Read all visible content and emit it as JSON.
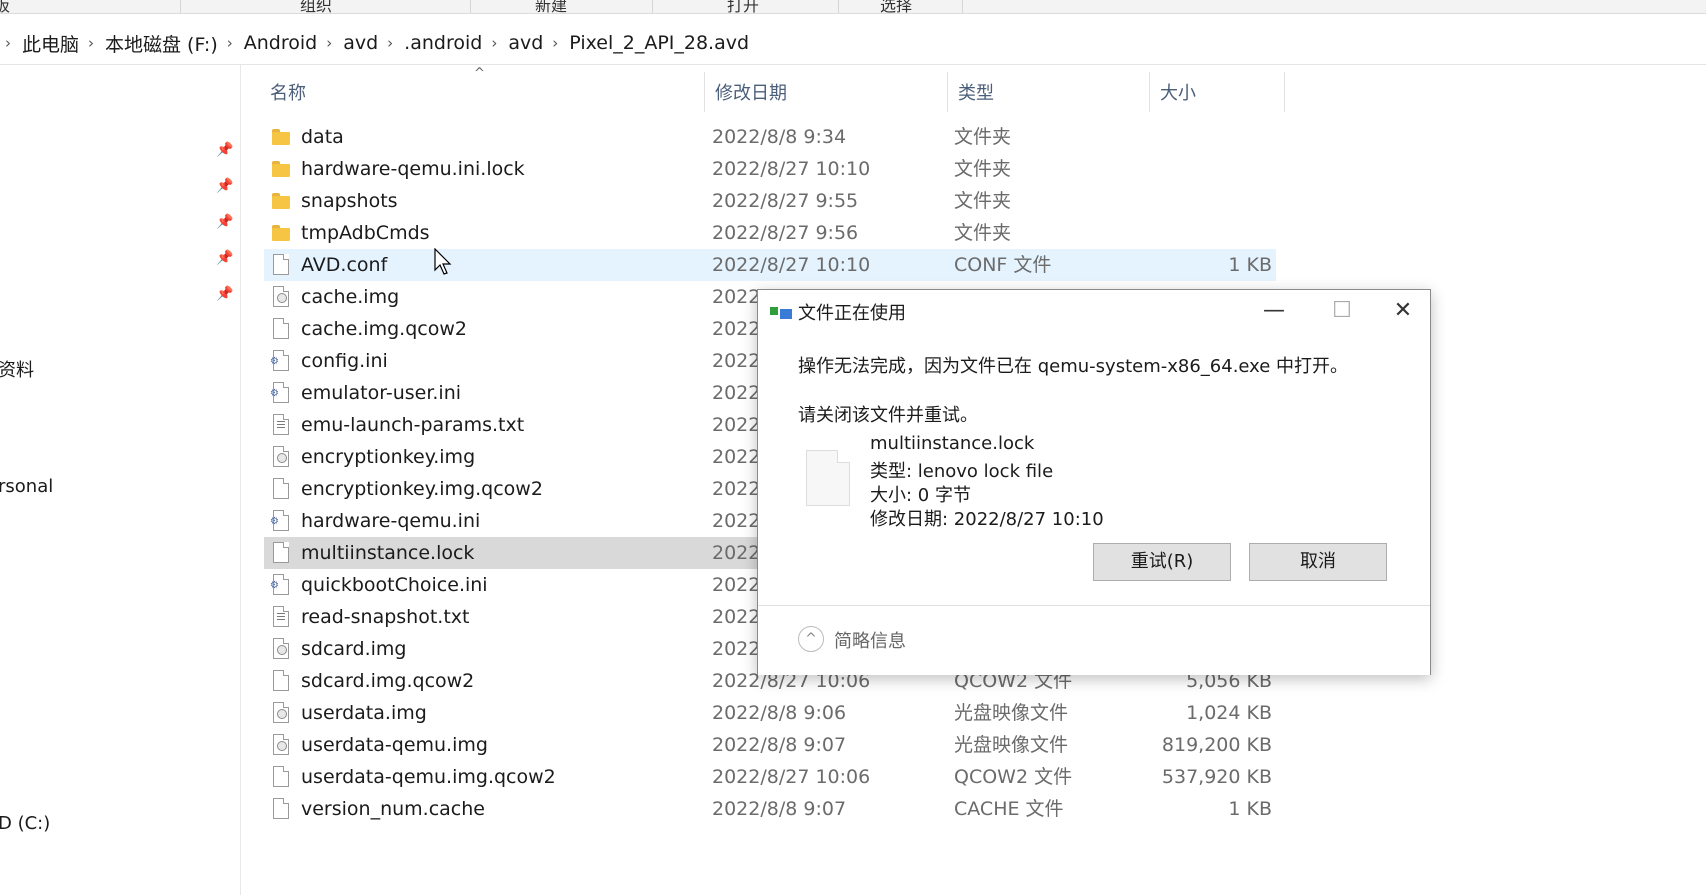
{
  "ribbon": {
    "groups": [
      "板",
      "组织",
      "新建",
      "打开",
      "选择"
    ]
  },
  "breadcrumb": [
    "此电脑",
    "本地磁盘 (F:)",
    "Android",
    "avd",
    ".android",
    "avd",
    "Pixel_2_API_28.avd"
  ],
  "nav": {
    "items": [
      "资料",
      "rsonal",
      "D (C:)"
    ]
  },
  "columns": {
    "name": "名称",
    "date": "修改日期",
    "type": "类型",
    "size": "大小"
  },
  "files": [
    {
      "name": "data",
      "date": "2022/8/8 9:34",
      "type": "文件夹",
      "size": "",
      "icon": "folder-icon"
    },
    {
      "name": "hardware-qemu.ini.lock",
      "date": "2022/8/27 10:10",
      "type": "文件夹",
      "size": "",
      "icon": "folder-icon"
    },
    {
      "name": "snapshots",
      "date": "2022/8/27 9:55",
      "type": "文件夹",
      "size": "",
      "icon": "folder-icon"
    },
    {
      "name": "tmpAdbCmds",
      "date": "2022/8/27 9:56",
      "type": "文件夹",
      "size": "",
      "icon": "folder-icon"
    },
    {
      "name": "AVD.conf",
      "date": "2022/8/27 10:10",
      "type": "CONF 文件",
      "size": "1 KB",
      "icon": "file-icon"
    },
    {
      "name": "cache.img",
      "date": "2022",
      "type": "",
      "size": "",
      "icon": "disc-file-icon"
    },
    {
      "name": "cache.img.qcow2",
      "date": "2022",
      "type": "",
      "size": "",
      "icon": "file-icon"
    },
    {
      "name": "config.ini",
      "date": "2022",
      "type": "",
      "size": "",
      "icon": "ini-file-icon"
    },
    {
      "name": "emulator-user.ini",
      "date": "2022",
      "type": "",
      "size": "",
      "icon": "ini-file-icon"
    },
    {
      "name": "emu-launch-params.txt",
      "date": "2022",
      "type": "",
      "size": "",
      "icon": "text-file-icon"
    },
    {
      "name": "encryptionkey.img",
      "date": "2022",
      "type": "",
      "size": "",
      "icon": "disc-file-icon"
    },
    {
      "name": "encryptionkey.img.qcow2",
      "date": "2022",
      "type": "",
      "size": "",
      "icon": "file-icon"
    },
    {
      "name": "hardware-qemu.ini",
      "date": "2022",
      "type": "",
      "size": "",
      "icon": "ini-file-icon"
    },
    {
      "name": "multiinstance.lock",
      "date": "2022",
      "type": "",
      "size": "",
      "icon": "file-icon"
    },
    {
      "name": "quickbootChoice.ini",
      "date": "2022",
      "type": "",
      "size": "",
      "icon": "ini-file-icon"
    },
    {
      "name": "read-snapshot.txt",
      "date": "2022",
      "type": "",
      "size": "",
      "icon": "text-file-icon"
    },
    {
      "name": "sdcard.img",
      "date": "2022",
      "type": "",
      "size": "",
      "icon": "disc-file-icon"
    },
    {
      "name": "sdcard.img.qcow2",
      "date": "2022/8/27 10:06",
      "type": "QCOW2 文件",
      "size": "5,056 KB",
      "icon": "file-icon"
    },
    {
      "name": "userdata.img",
      "date": "2022/8/8 9:06",
      "type": "光盘映像文件",
      "size": "1,024 KB",
      "icon": "disc-file-icon"
    },
    {
      "name": "userdata-qemu.img",
      "date": "2022/8/8 9:07",
      "type": "光盘映像文件",
      "size": "819,200 KB",
      "icon": "disc-file-icon"
    },
    {
      "name": "userdata-qemu.img.qcow2",
      "date": "2022/8/27 10:06",
      "type": "QCOW2 文件",
      "size": "537,920 KB",
      "icon": "file-icon"
    },
    {
      "name": "version_num.cache",
      "date": "2022/8/8 9:07",
      "type": "CACHE 文件",
      "size": "1 KB",
      "icon": "file-icon"
    }
  ],
  "dialog": {
    "title": "文件正在使用",
    "message": "操作无法完成，因为文件已在 qemu-system-x86_64.exe 中打开。",
    "instruction": "请关闭该文件并重试。",
    "file_name": "multiinstance.lock",
    "file_type": "类型: lenovo lock file",
    "file_size": "大小: 0 字节",
    "file_modified": "修改日期: 2022/8/27 10:10",
    "retry_label": "重试(R)",
    "cancel_label": "取消",
    "details_label": "简略信息",
    "min_glyph": "—",
    "max_glyph": "☐",
    "close_glyph": "✕",
    "chevron_glyph": "^"
  }
}
